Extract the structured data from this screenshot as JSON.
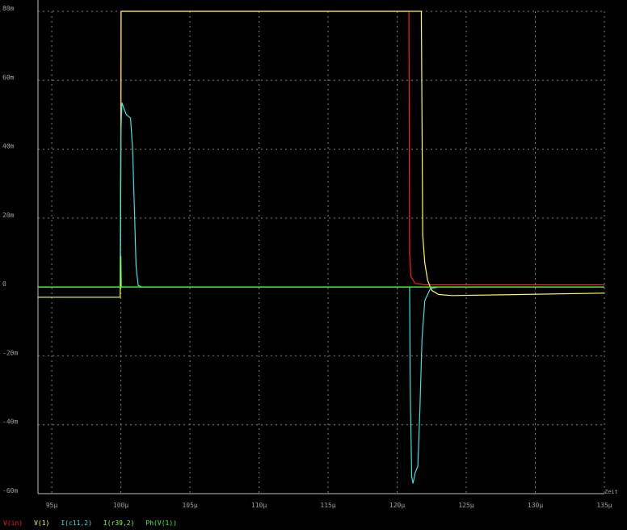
{
  "chart_data": {
    "type": "line",
    "xlabel": "Zeit",
    "ylabel": "",
    "x_ticks": [
      "95µ",
      "100µ",
      "105µ",
      "110µ",
      "115µ",
      "120µ",
      "125µ",
      "130µ",
      "135µ"
    ],
    "y_ticks": [
      "80m",
      "60m",
      "40m",
      "20m",
      "0",
      "-20m",
      "-40m",
      "-60m"
    ],
    "xlim": [
      94,
      135
    ],
    "ylim": [
      -60,
      80
    ],
    "x_unit_scale": "µs",
    "y_unit_scale": "m",
    "grid": true,
    "background": "#000000",
    "grid_color": "#808080",
    "legend_position": "bottom-left",
    "series": [
      {
        "name": "V(in)",
        "color": "#ff2020",
        "points": [
          [
            94,
            0
          ],
          [
            99.97,
            0
          ],
          [
            100,
            200
          ],
          [
            120.85,
            200
          ],
          [
            120.9,
            10
          ],
          [
            121.0,
            3
          ],
          [
            121.3,
            1
          ],
          [
            122,
            0.6
          ],
          [
            135,
            0.6
          ]
        ]
      },
      {
        "name": "V(1)",
        "color": "#ffff40",
        "points": [
          [
            94,
            -3
          ],
          [
            99.95,
            -3
          ],
          [
            100,
            35
          ],
          [
            100.02,
            200
          ],
          [
            121.75,
            200
          ],
          [
            121.85,
            15
          ],
          [
            122.0,
            7
          ],
          [
            122.2,
            2
          ],
          [
            122.5,
            -1
          ],
          [
            123,
            -2.2
          ],
          [
            124,
            -2.5
          ],
          [
            135,
            -1.8
          ]
        ]
      },
      {
        "name": "I(c11,2)",
        "color": "#40e0e0",
        "points": [
          [
            94,
            0
          ],
          [
            99.95,
            0
          ],
          [
            100,
            44
          ],
          [
            100.08,
            53.5
          ],
          [
            100.2,
            52
          ],
          [
            100.4,
            50
          ],
          [
            100.7,
            49
          ],
          [
            100.85,
            40
          ],
          [
            101.0,
            20
          ],
          [
            101.1,
            6
          ],
          [
            101.25,
            0.5
          ],
          [
            101.5,
            0
          ],
          [
            120.9,
            0
          ],
          [
            120.95,
            -30
          ],
          [
            121.05,
            -55
          ],
          [
            121.15,
            -57
          ],
          [
            121.3,
            -54
          ],
          [
            121.5,
            -52
          ],
          [
            121.65,
            -35
          ],
          [
            121.8,
            -15
          ],
          [
            122.0,
            -4
          ],
          [
            122.4,
            -0.5
          ],
          [
            123,
            0
          ],
          [
            135,
            0
          ]
        ]
      },
      {
        "name": "I(r39,2)",
        "color": "#80ff40",
        "points": [
          [
            94,
            0
          ],
          [
            99.97,
            0
          ],
          [
            100,
            9
          ],
          [
            100.03,
            0
          ],
          [
            135,
            0
          ]
        ]
      },
      {
        "name": "Ph(V(1))",
        "color": "#40ff40",
        "points": [
          [
            94,
            0
          ],
          [
            135,
            0
          ]
        ]
      }
    ]
  }
}
